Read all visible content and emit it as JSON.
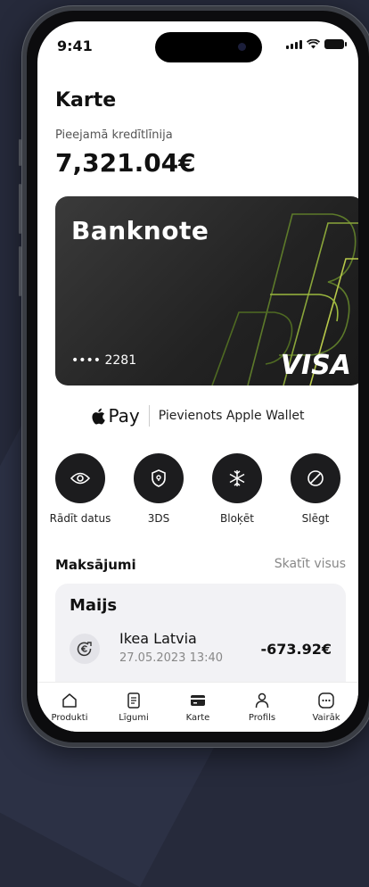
{
  "status": {
    "time": "9:41"
  },
  "header": {
    "title": "Karte"
  },
  "credit": {
    "label": "Pieejamā kredītlīnija",
    "value": "7,321.04€"
  },
  "card": {
    "brand": "Banknote",
    "masked_number": "•••• 2281",
    "network": "VISA"
  },
  "apple_pay": {
    "pay_label": "Pay",
    "wallet_label": "Pievienots Apple Wallet"
  },
  "actions": [
    {
      "label": "Rādīt datus",
      "icon": "eye-icon"
    },
    {
      "label": "3DS",
      "icon": "shield-icon"
    },
    {
      "label": "Bloķēt",
      "icon": "snowflake-icon"
    },
    {
      "label": "Slēgt",
      "icon": "block-icon"
    }
  ],
  "payments": {
    "heading": "Maksājumi",
    "view_all": "Skatīt visus",
    "month": "Maijs",
    "transactions": [
      {
        "merchant": "Ikea Latvia",
        "datetime": "27.05.2023 13:40",
        "amount": "-673.92€"
      }
    ]
  },
  "tabbar": [
    {
      "label": "Produkti",
      "icon": "home-icon"
    },
    {
      "label": "Līgumi",
      "icon": "document-icon"
    },
    {
      "label": "Karte",
      "icon": "card-icon"
    },
    {
      "label": "Profils",
      "icon": "profile-icon"
    },
    {
      "label": "Vairāk",
      "icon": "more-icon"
    }
  ]
}
